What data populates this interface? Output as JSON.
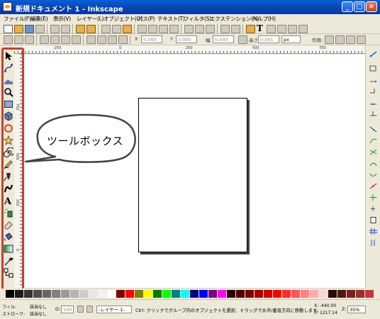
{
  "window": {
    "title": "新規ドキュメント 1 - Inkscape",
    "buttons": {
      "minimize": "_",
      "maximize": "□",
      "close": "×"
    }
  },
  "menu": [
    "ファイル(F)",
    "編集(E)",
    "表示(V)",
    "レイヤー(L)",
    "オブジェクト(O)",
    "パス(P)",
    "テキスト(T)",
    "フィルタ(S)",
    "エクステンション(N)",
    "ヘルプ(H)"
  ],
  "toolbar": {
    "x_label": "X",
    "x_value": "0.000",
    "y_label": "Y",
    "y_value": "0.000",
    "w_label": "幅",
    "w_value": "0.000",
    "h_label": "高さ",
    "h_value": "0.001",
    "unit": "px",
    "affect_label": "作用:"
  },
  "rulers": {
    "horizontal_ticks": [
      "-250",
      "0",
      "250",
      "500",
      "750"
    ],
    "vertical_ticks": [
      "750",
      "500",
      "250",
      "0"
    ]
  },
  "tools": [
    {
      "name": "selector-tool-icon"
    },
    {
      "name": "node-tool-icon"
    },
    {
      "name": "tweak-tool-icon"
    },
    {
      "name": "zoom-tool-icon"
    },
    {
      "name": "rectangle-tool-icon"
    },
    {
      "name": "3d-box-tool-icon"
    },
    {
      "name": "ellipse-tool-icon"
    },
    {
      "name": "star-tool-icon"
    },
    {
      "name": "spiral-tool-icon"
    },
    {
      "name": "pencil-tool-icon"
    },
    {
      "name": "pen-tool-icon"
    },
    {
      "name": "calligraphy-tool-icon"
    },
    {
      "name": "text-tool-icon"
    },
    {
      "name": "spray-tool-icon"
    },
    {
      "name": "eraser-tool-icon"
    },
    {
      "name": "paint-bucket-tool-icon"
    },
    {
      "name": "gradient-tool-icon"
    },
    {
      "name": "dropper-tool-icon"
    },
    {
      "name": "connector-tool-icon"
    }
  ],
  "callout": {
    "text": "ツールボックス"
  },
  "palette": [
    "#000000",
    "#1a1a1a",
    "#333333",
    "#4d4d4d",
    "#666666",
    "#808080",
    "#999999",
    "#b3b3b3",
    "#cccccc",
    "#e6e6e6",
    "#f2f2f2",
    "#ffffff",
    "#800000",
    "#ff0000",
    "#808000",
    "#ffff00",
    "#008000",
    "#00ff00",
    "#008080",
    "#00ffff",
    "#000080",
    "#0000ff",
    "#800080",
    "#ff00ff",
    "#2b0000",
    "#550000",
    "#800000",
    "#aa0000",
    "#d40000",
    "#ff0000",
    "#ff2a2a",
    "#ff5555",
    "#ff8080",
    "#ffaaaa",
    "#ffd5d5",
    "#280b0b",
    "#501616",
    "#782121",
    "#a02c2c",
    "#c83737"
  ],
  "status": {
    "fill_label": "フィル:",
    "fill_value": "該当なし",
    "stroke_label": "ストローク:",
    "stroke_value": "該当なし",
    "opacity_label": "O:",
    "opacity_value": "100",
    "layer": "-レイヤー 1-",
    "message": "Ctrl: クリックでグループ内のオブジェクトを選択、ドラッグで水平/垂直方向に移動します。",
    "x_label": "X:",
    "x_value": "-440.00",
    "y_label": "Y:",
    "y_value": "1217.14",
    "zoom_label": "Z:",
    "zoom_value": "35%"
  }
}
